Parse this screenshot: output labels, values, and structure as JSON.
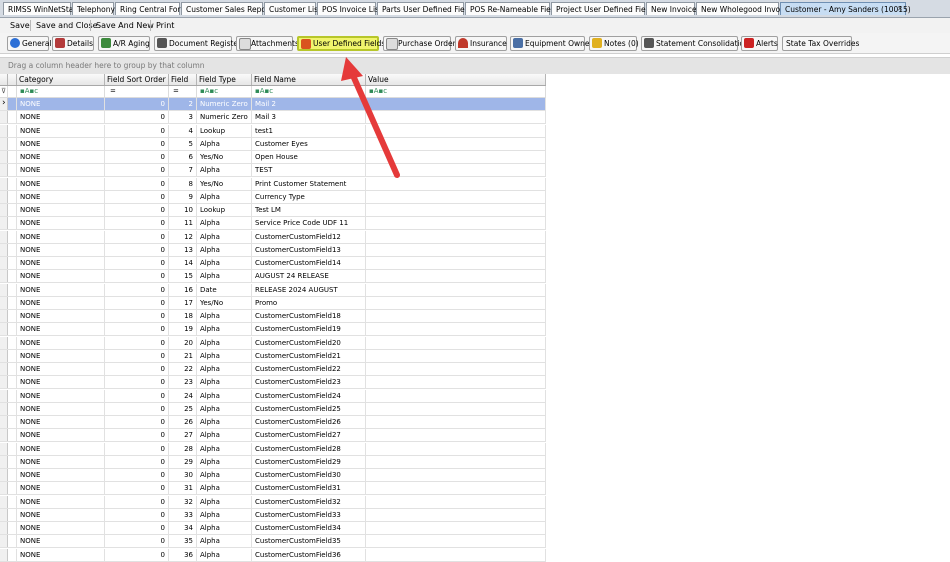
{
  "doc_tabs": [
    {
      "label": "RIMSS WinNetStar"
    },
    {
      "label": "Telephony"
    },
    {
      "label": "Ring Central Form"
    },
    {
      "label": "Customer Sales Report"
    },
    {
      "label": "Customer List"
    },
    {
      "label": "POS Invoice List"
    },
    {
      "label": "Parts User Defined Fields"
    },
    {
      "label": "POS Re-Nameable Fields"
    },
    {
      "label": "Project User Defined Fields"
    },
    {
      "label": "New Invoice"
    },
    {
      "label": "New Wholegood Invoice"
    },
    {
      "label": "Customer - Amy Sanders (10015)",
      "close": "✕"
    }
  ],
  "toolbar": {
    "save": "Save",
    "save_close": "Save and Close",
    "save_new": "Save And New",
    "print": "Print"
  },
  "subtabs": [
    {
      "label": "General",
      "icon": "info-icon",
      "color": "#2c6fd6"
    },
    {
      "label": "Details",
      "icon": "details-icon",
      "color": "#b33a3a"
    },
    {
      "label": "A/R Aging",
      "icon": "ar-aging-icon",
      "color": "#3c8a3c"
    },
    {
      "label": "Document Register",
      "icon": "document-register-icon",
      "color": "#555555"
    },
    {
      "label": "Attachments",
      "icon": "attachments-icon",
      "color": "#888888"
    },
    {
      "label": "User Defined Fields",
      "icon": "user-defined-fields-icon",
      "color": "#d9541f"
    },
    {
      "label": "Purchase Orders",
      "icon": "purchase-orders-icon",
      "color": "#777777"
    },
    {
      "label": "Insurance",
      "icon": "umbrella-icon",
      "color": "#c0392b"
    },
    {
      "label": "Equipment Owned",
      "icon": "equipment-icon",
      "color": "#4a6fa5"
    },
    {
      "label": "Notes (0)",
      "icon": "notes-icon",
      "color": "#e0b020"
    },
    {
      "label": "Statement Consolidation",
      "icon": "statement-icon",
      "color": "#555555"
    },
    {
      "label": "Alerts",
      "icon": "flag-icon",
      "color": "#cc2222"
    },
    {
      "label": "State Tax Overrides",
      "icon": "",
      "color": ""
    }
  ],
  "group_hint": "Drag a column header here to group by that column",
  "columns": [
    "Category",
    "Field Sort Order",
    "Field",
    "Field Type",
    "Field Name",
    "Value"
  ],
  "filter_symbols": {
    "eq": "=",
    "like": "▪A▪c"
  },
  "rows": [
    {
      "category": "NONE",
      "sort": "0",
      "field": "2",
      "type": "Numeric Zero",
      "name": "Mail 2",
      "value": "",
      "selected": true
    },
    {
      "category": "NONE",
      "sort": "0",
      "field": "3",
      "type": "Numeric Zero",
      "name": "Mail 3",
      "value": ""
    },
    {
      "category": "NONE",
      "sort": "0",
      "field": "4",
      "type": "Lookup",
      "name": "test1",
      "value": ""
    },
    {
      "category": "NONE",
      "sort": "0",
      "field": "5",
      "type": "Alpha",
      "name": "Customer Eyes",
      "value": ""
    },
    {
      "category": "NONE",
      "sort": "0",
      "field": "6",
      "type": "Yes/No",
      "name": "Open House",
      "value": ""
    },
    {
      "category": "NONE",
      "sort": "0",
      "field": "7",
      "type": "Alpha",
      "name": "TEST",
      "value": ""
    },
    {
      "category": "NONE",
      "sort": "0",
      "field": "8",
      "type": "Yes/No",
      "name": "Print Customer Statement",
      "value": ""
    },
    {
      "category": "NONE",
      "sort": "0",
      "field": "9",
      "type": "Alpha",
      "name": "Currency Type",
      "value": ""
    },
    {
      "category": "NONE",
      "sort": "0",
      "field": "10",
      "type": "Lookup",
      "name": "Test LM",
      "value": ""
    },
    {
      "category": "NONE",
      "sort": "0",
      "field": "11",
      "type": "Alpha",
      "name": "Service Price Code UDF 11",
      "value": ""
    },
    {
      "category": "NONE",
      "sort": "0",
      "field": "12",
      "type": "Alpha",
      "name": "CustomerCustomField12",
      "value": ""
    },
    {
      "category": "NONE",
      "sort": "0",
      "field": "13",
      "type": "Alpha",
      "name": "CustomerCustomField13",
      "value": ""
    },
    {
      "category": "NONE",
      "sort": "0",
      "field": "14",
      "type": "Alpha",
      "name": "CustomerCustomField14",
      "value": ""
    },
    {
      "category": "NONE",
      "sort": "0",
      "field": "15",
      "type": "Alpha",
      "name": "AUGUST 24 RELEASE",
      "value": ""
    },
    {
      "category": "NONE",
      "sort": "0",
      "field": "16",
      "type": "Date",
      "name": "RELEASE 2024 AUGUST",
      "value": ""
    },
    {
      "category": "NONE",
      "sort": "0",
      "field": "17",
      "type": "Yes/No",
      "name": "Promo",
      "value": ""
    },
    {
      "category": "NONE",
      "sort": "0",
      "field": "18",
      "type": "Alpha",
      "name": "CustomerCustomField18",
      "value": ""
    },
    {
      "category": "NONE",
      "sort": "0",
      "field": "19",
      "type": "Alpha",
      "name": "CustomerCustomField19",
      "value": ""
    },
    {
      "category": "NONE",
      "sort": "0",
      "field": "20",
      "type": "Alpha",
      "name": "CustomerCustomField20",
      "value": ""
    },
    {
      "category": "NONE",
      "sort": "0",
      "field": "21",
      "type": "Alpha",
      "name": "CustomerCustomField21",
      "value": ""
    },
    {
      "category": "NONE",
      "sort": "0",
      "field": "22",
      "type": "Alpha",
      "name": "CustomerCustomField22",
      "value": ""
    },
    {
      "category": "NONE",
      "sort": "0",
      "field": "23",
      "type": "Alpha",
      "name": "CustomerCustomField23",
      "value": ""
    },
    {
      "category": "NONE",
      "sort": "0",
      "field": "24",
      "type": "Alpha",
      "name": "CustomerCustomField24",
      "value": ""
    },
    {
      "category": "NONE",
      "sort": "0",
      "field": "25",
      "type": "Alpha",
      "name": "CustomerCustomField25",
      "value": ""
    },
    {
      "category": "NONE",
      "sort": "0",
      "field": "26",
      "type": "Alpha",
      "name": "CustomerCustomField26",
      "value": ""
    },
    {
      "category": "NONE",
      "sort": "0",
      "field": "27",
      "type": "Alpha",
      "name": "CustomerCustomField27",
      "value": ""
    },
    {
      "category": "NONE",
      "sort": "0",
      "field": "28",
      "type": "Alpha",
      "name": "CustomerCustomField28",
      "value": ""
    },
    {
      "category": "NONE",
      "sort": "0",
      "field": "29",
      "type": "Alpha",
      "name": "CustomerCustomField29",
      "value": ""
    },
    {
      "category": "NONE",
      "sort": "0",
      "field": "30",
      "type": "Alpha",
      "name": "CustomerCustomField30",
      "value": ""
    },
    {
      "category": "NONE",
      "sort": "0",
      "field": "31",
      "type": "Alpha",
      "name": "CustomerCustomField31",
      "value": ""
    },
    {
      "category": "NONE",
      "sort": "0",
      "field": "32",
      "type": "Alpha",
      "name": "CustomerCustomField32",
      "value": ""
    },
    {
      "category": "NONE",
      "sort": "0",
      "field": "33",
      "type": "Alpha",
      "name": "CustomerCustomField33",
      "value": ""
    },
    {
      "category": "NONE",
      "sort": "0",
      "field": "34",
      "type": "Alpha",
      "name": "CustomerCustomField34",
      "value": ""
    },
    {
      "category": "NONE",
      "sort": "0",
      "field": "35",
      "type": "Alpha",
      "name": "CustomerCustomField35",
      "value": ""
    },
    {
      "category": "NONE",
      "sort": "0",
      "field": "36",
      "type": "Alpha",
      "name": "CustomerCustomField36",
      "value": ""
    }
  ],
  "colors": {
    "selected_row": "#9fb6e8",
    "highlight_tab": "#f1f56d",
    "annotation_arrow": "#e53a3a",
    "active_doc_tab": "#c7ddf3"
  }
}
